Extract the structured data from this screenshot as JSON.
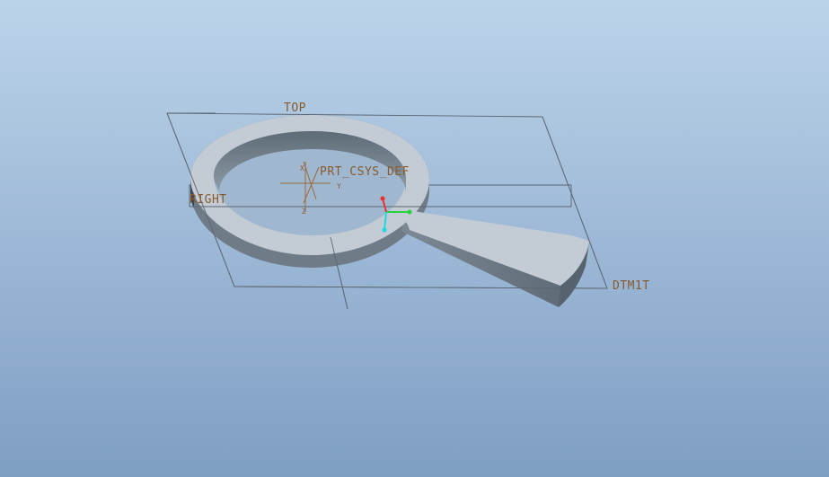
{
  "viewport": {
    "background_top": "#bcd4ea",
    "background_bottom": "#7f9ec4"
  },
  "datums": {
    "top_plane": "TOP",
    "right_plane": "RIGHT",
    "dtm_plane": "DTM1T",
    "csys": "PRT_CSYS_DEF",
    "csys_axes": {
      "x": "X",
      "y": "Y",
      "z": "Z"
    }
  },
  "colors": {
    "plane_edge": "#5c6670",
    "datum_text": "#8a5a2e",
    "csys_lines": "#9a6a3e",
    "part_top": "#c3ccd5",
    "part_side": "#6f7c88",
    "part_side_dark": "#56626d",
    "part_inner": "#7a8894",
    "triad_x": "#28d23c",
    "triad_y": "#e83030",
    "triad_z": "#20d8e0"
  },
  "icons": {
    "triad": "view-orientation-triad-icon"
  }
}
